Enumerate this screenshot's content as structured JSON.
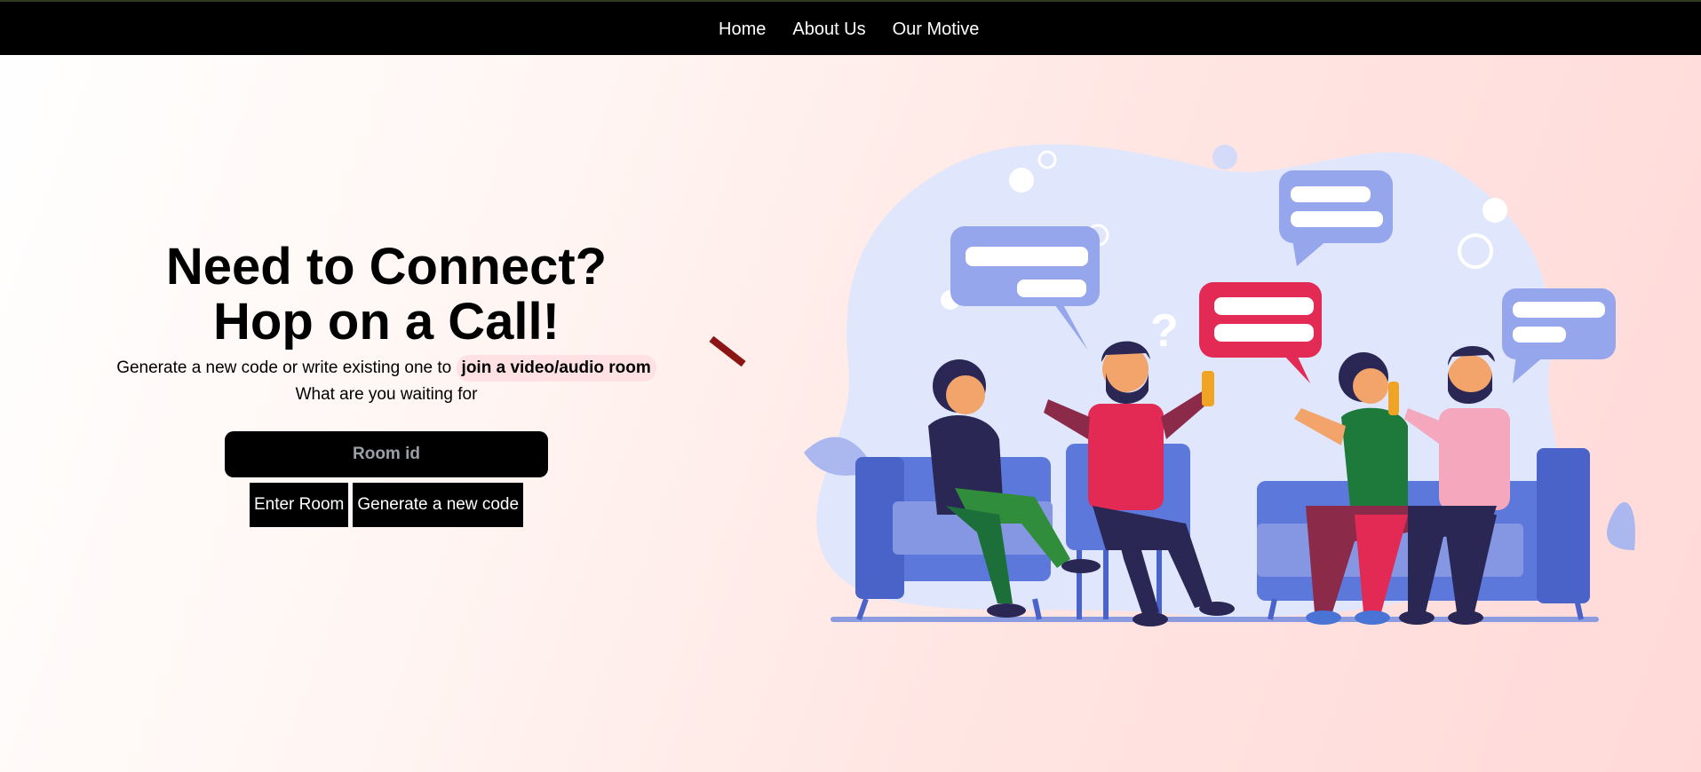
{
  "nav": {
    "links": [
      "Home",
      "About Us",
      "Our Motive"
    ]
  },
  "hero": {
    "title_line1": "Need to Connect?",
    "title_line2": "Hop on a Call!",
    "subtitle_prefix": "Generate a new code or write existing one to",
    "subtitle_highlight": "join a video/audio room",
    "subtitle_line2": "What are you waiting for"
  },
  "form": {
    "room_placeholder": "Room id",
    "enter_label": "Enter Room",
    "generate_label": "Generate a new code"
  },
  "colors": {
    "navbar": "#000000",
    "accent_dash": "#8b1414",
    "highlight": "#ffe0e3"
  }
}
